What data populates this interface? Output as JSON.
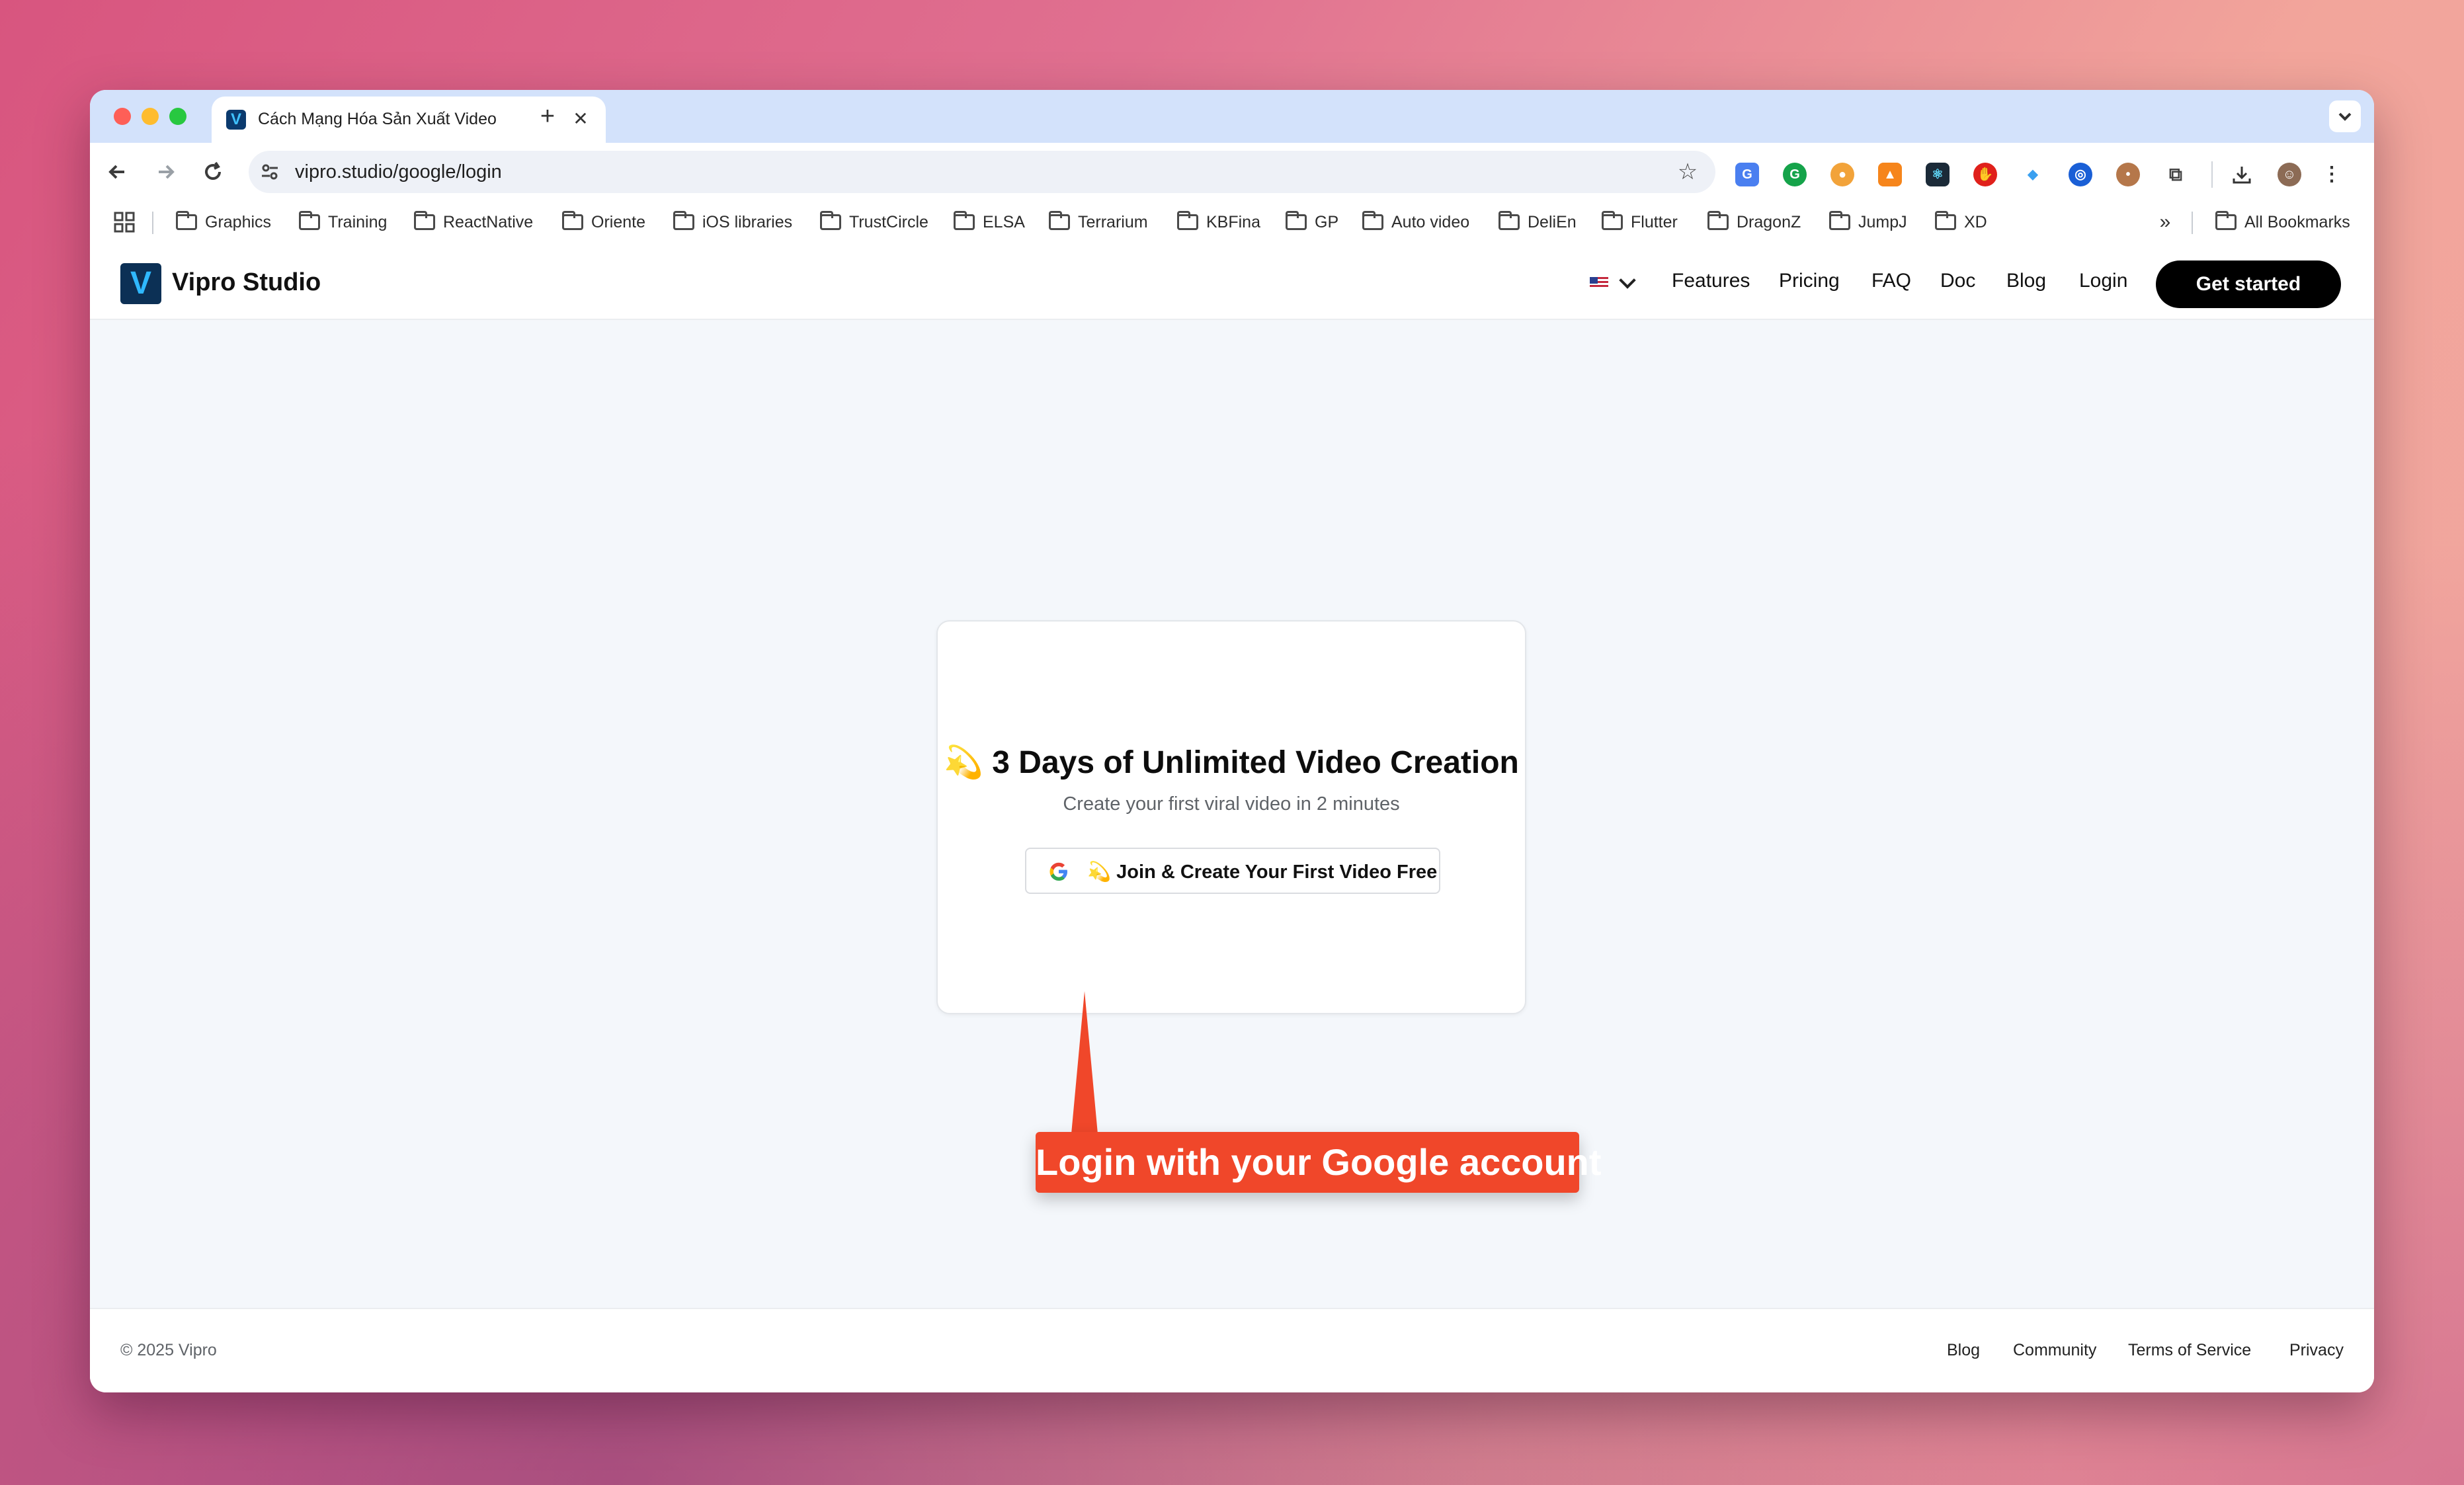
{
  "browser": {
    "tab_title": "Cách Mạng Hóa Sản Xuất Video",
    "tab_close": "✕",
    "new_tab": "+",
    "url": "vipro.studio/google/login",
    "icons": [
      "back-icon",
      "forward-icon",
      "reload-icon",
      "site-settings-icon",
      "bookmark-star-icon",
      "translate-icon",
      "grammarly-icon",
      "extension-icon",
      "metamask-icon",
      "react-devtools-icon",
      "adblock-icon",
      "extension-icon",
      "extension-icon",
      "cookie-icon",
      "puzzle-icon",
      "download-icon",
      "profile-avatar",
      "more-menu-icon"
    ]
  },
  "bookmarks": {
    "items": [
      "Graphics",
      "Training",
      "ReactNative",
      "Oriente",
      "iOS libraries",
      "TrustCircle",
      "ELSA",
      "Terrarium",
      "KBFina",
      "GP",
      "Auto video",
      "DeliEn",
      "Flutter",
      "DragonZ",
      "JumpJ",
      "XD"
    ],
    "overflow": "»",
    "all_bookmarks": "All Bookmarks"
  },
  "site": {
    "brand": "Vipro Studio",
    "logo_letter": "V",
    "nav": [
      "Features",
      "Pricing",
      "FAQ",
      "Doc",
      "Blog",
      "Login"
    ],
    "cta": "Get started"
  },
  "card": {
    "title": "💫 3 Days of Unlimited Video Creation",
    "subtitle": "Create your first viral video in 2 minutes",
    "google_button": "💫 Join & Create Your First Video Free"
  },
  "annotation": {
    "callout": "Login with your Google account",
    "color": "#f0472a"
  },
  "footer": {
    "copyright": "© 2025 Vipro",
    "links": [
      "Blog",
      "Community",
      "Terms of Service",
      "Privacy"
    ]
  }
}
